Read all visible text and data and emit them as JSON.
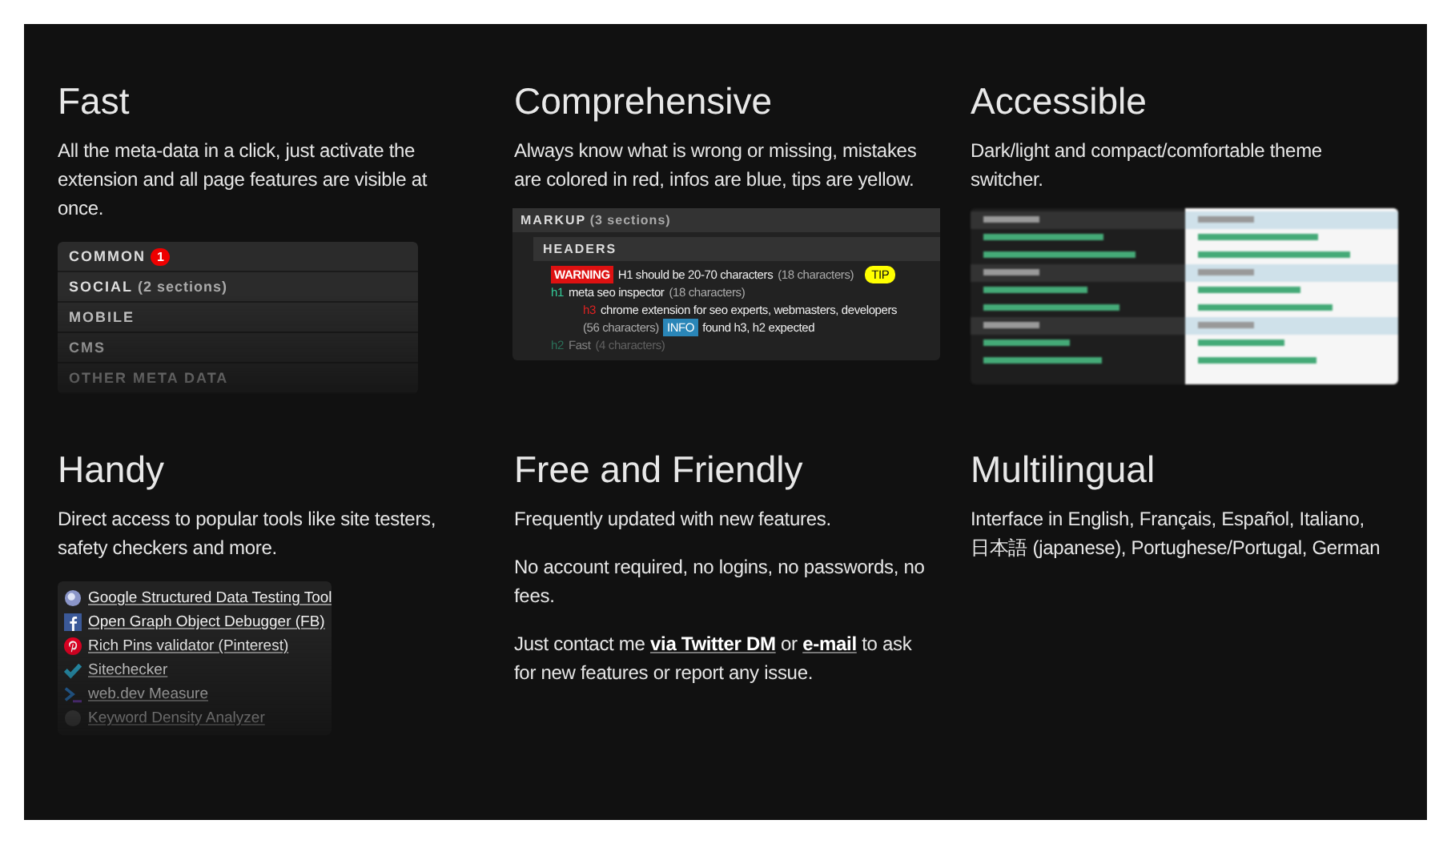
{
  "features": [
    {
      "title": "Fast",
      "paragraphs": [
        [
          {
            "kind": "text",
            "text": "All the meta-data in a click, just activate the extension and all page features are visible at once."
          }
        ]
      ],
      "demo": {
        "kind": "menu",
        "items": [
          {
            "label": "COMMON",
            "badge": "1"
          },
          {
            "label": "SOCIAL",
            "note": "(2 sections)"
          },
          {
            "label": "MOBILE"
          },
          {
            "label": "CMS"
          },
          {
            "label": "OTHER META DATA"
          }
        ]
      }
    },
    {
      "title": "Comprehensive",
      "paragraphs": [
        [
          {
            "kind": "text",
            "text": "Always know what is wrong or missing, mistakes are colored in red, infos are blue, tips are yellow."
          }
        ]
      ],
      "demo": {
        "kind": "markup",
        "header": "MARKUP",
        "note": "(3 sections)",
        "subheader": "HEADERS",
        "lines": [
          {
            "parts": [
              {
                "kind": "warning",
                "text": "WARNING"
              },
              {
                "kind": "text",
                "text": "H1 should be 20-70 characters"
              },
              {
                "kind": "note",
                "text": "(18 characters)"
              },
              {
                "kind": "tip",
                "text": "TIP"
              }
            ]
          },
          {
            "parts": [
              {
                "kind": "ok-tag",
                "text": "h1"
              },
              {
                "kind": "text",
                "text": "meta seo inspector"
              },
              {
                "kind": "note",
                "text": "(18 characters)"
              }
            ],
            "children": [
              {
                "parts": [
                  {
                    "kind": "bad-tag",
                    "text": "h3"
                  },
                  {
                    "kind": "text",
                    "text": "chrome extension for seo experts, webmasters, developers"
                  },
                  {
                    "kind": "note",
                    "text": "(56 characters)"
                  },
                  {
                    "kind": "info",
                    "text": "INFO"
                  },
                  {
                    "kind": "text",
                    "text": "found h3, h2 expected"
                  }
                ]
              }
            ]
          },
          {
            "parts": [
              {
                "kind": "ok-tag",
                "text": "h2"
              },
              {
                "kind": "text",
                "text": "Fast"
              },
              {
                "kind": "note",
                "text": "(4 characters)"
              }
            ]
          }
        ]
      }
    },
    {
      "title": "Accessible",
      "paragraphs": [
        [
          {
            "kind": "text",
            "text": "Dark/light and compact/comfortable theme switcher."
          }
        ]
      ],
      "demo": {
        "kind": "themes"
      }
    },
    {
      "title": "Handy",
      "paragraphs": [
        [
          {
            "kind": "text",
            "text": "Direct access to popular tools like site testers, safety checkers and more."
          }
        ]
      ],
      "demo": {
        "kind": "tools",
        "items": [
          {
            "label": "Google Structured Data Testing Tool"
          },
          {
            "label": "Open Graph Object Debugger (FB)"
          },
          {
            "label": "Rich Pins validator (Pinterest)"
          },
          {
            "label": "Sitechecker"
          },
          {
            "label": "web.dev Measure"
          },
          {
            "label": "Keyword Density Analyzer"
          }
        ]
      }
    },
    {
      "title": "Free and Friendly",
      "paragraphs": [
        [
          {
            "kind": "text",
            "text": "Frequently updated with new features."
          }
        ],
        [
          {
            "kind": "text",
            "text": "No account required, no logins, no passwords, no fees."
          }
        ],
        [
          {
            "kind": "text",
            "text": "Just contact me "
          },
          {
            "kind": "link",
            "text": "via Twitter DM"
          },
          {
            "kind": "text",
            "text": " or "
          },
          {
            "kind": "link",
            "text": "e-mail"
          },
          {
            "kind": "text",
            "text": " to ask for new features or report any issue."
          }
        ]
      ],
      "demo": {
        "kind": "none"
      }
    },
    {
      "title": "Multilingual",
      "paragraphs": [
        [
          {
            "kind": "text",
            "text": "Interface in English, Français, Español, Italiano, 日本語 (japanese), Portughese/Portugal, German"
          }
        ]
      ],
      "demo": {
        "kind": "none"
      }
    }
  ]
}
